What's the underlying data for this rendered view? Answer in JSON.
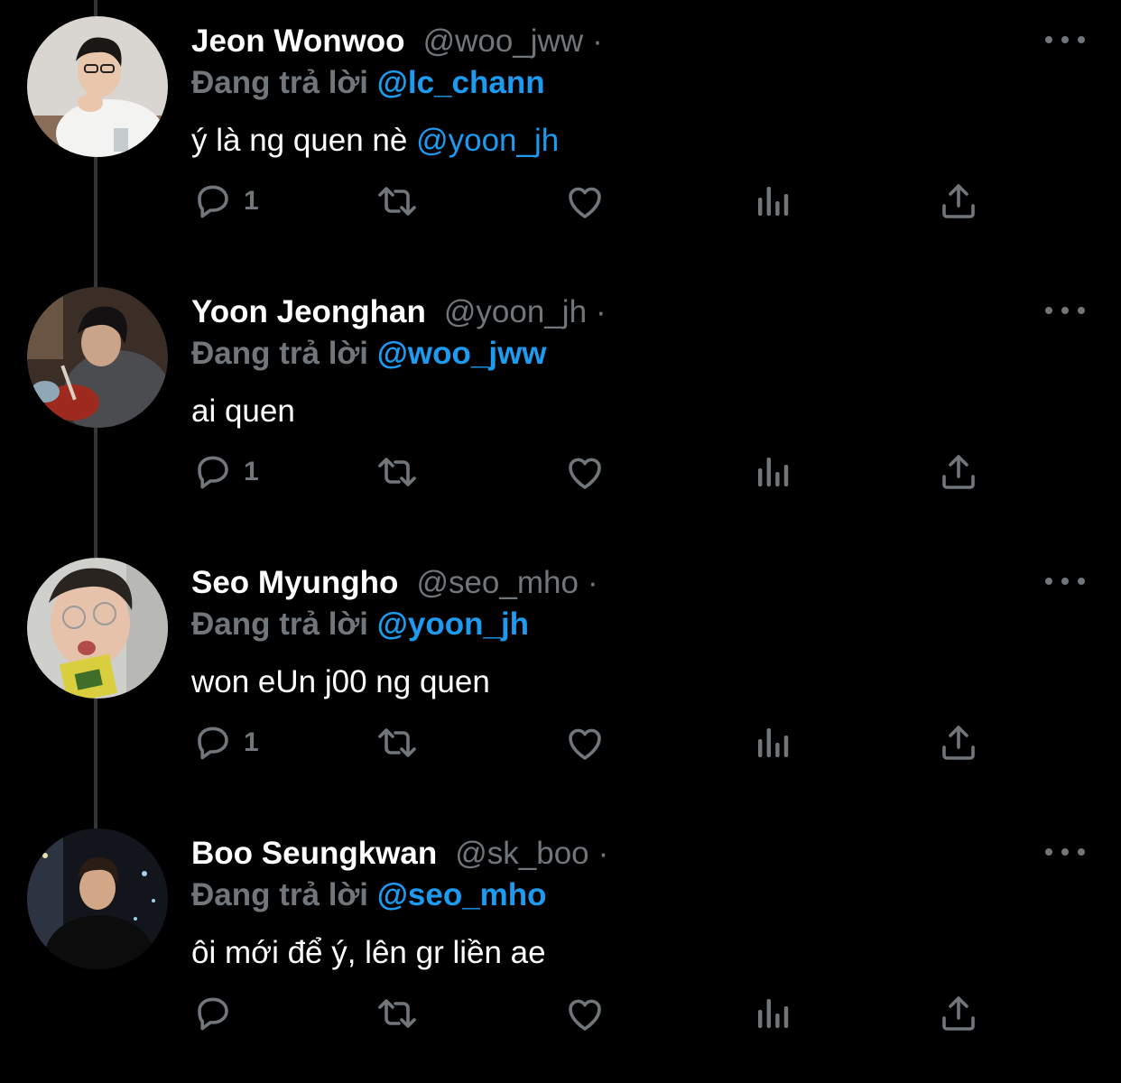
{
  "colors": {
    "background": "#000000",
    "name": "#ffffff",
    "muted": "#71767b",
    "accent": "#1d9bf0"
  },
  "reply_prefix": "Đang trả lời",
  "tweets": [
    {
      "name": "Jeon Wonwoo",
      "handle": "@woo_jww",
      "dot": "·",
      "replying_to": "@lc_chann",
      "text": "ý là ng quen nè ",
      "text_mention": "@yoon_jh",
      "reply_count": "1"
    },
    {
      "name": "Yoon Jeonghan",
      "handle": "@yoon_jh",
      "dot": "·",
      "replying_to": "@woo_jww",
      "text": "ai quen",
      "text_mention": "",
      "reply_count": "1"
    },
    {
      "name": "Seo Myungho",
      "handle": "@seo_mho",
      "dot": "·",
      "replying_to": "@yoon_jh",
      "text": "won eUn j00 ng quen",
      "text_mention": "",
      "reply_count": "1"
    },
    {
      "name": "Boo Seungkwan",
      "handle": "@sk_boo",
      "dot": "·",
      "replying_to": "@seo_mho",
      "text": "ôi mới để ý, lên gr liền ae",
      "text_mention": "",
      "reply_count": ""
    }
  ],
  "icons": [
    "reply-icon",
    "retweet-icon",
    "like-icon",
    "views-icon",
    "share-icon",
    "more-icon"
  ]
}
